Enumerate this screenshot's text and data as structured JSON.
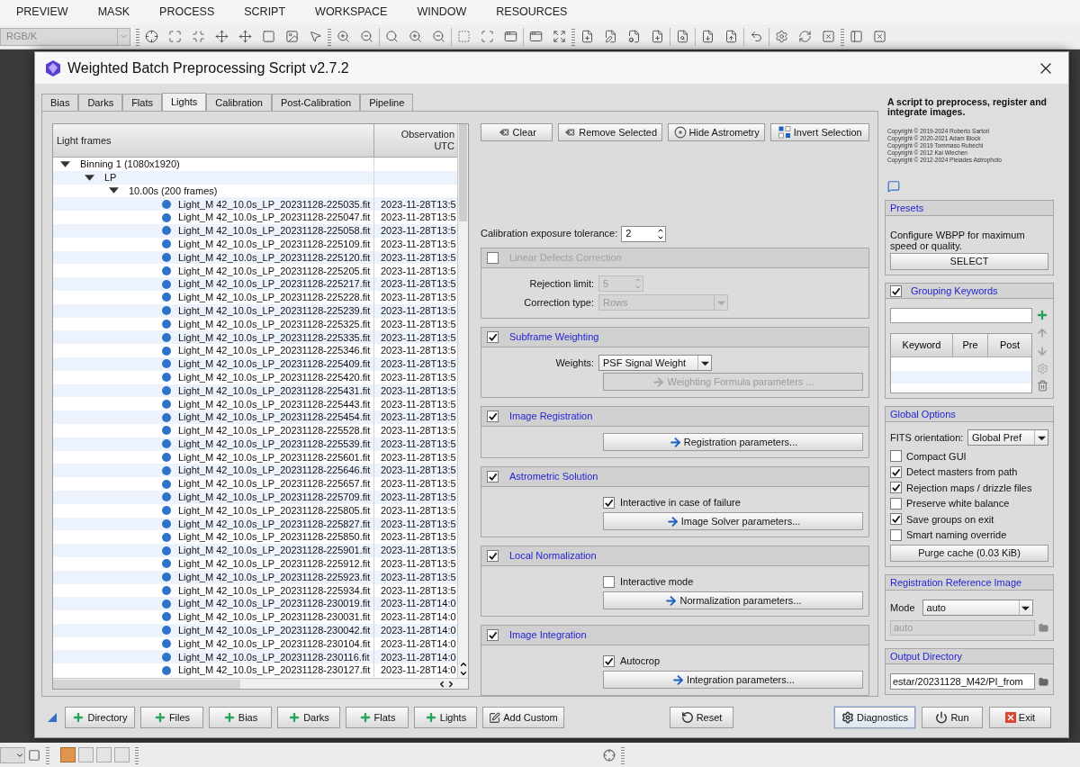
{
  "menu_bar": [
    "PREVIEW",
    "MASK",
    "PROCESS",
    "SCRIPT",
    "WORKSPACE",
    "WINDOW",
    "RESOURCES"
  ],
  "toolbar": {
    "view_select": "RGB/K"
  },
  "window": {
    "title": "Weighted Batch Preprocessing Script v2.7.2"
  },
  "tabs": [
    {
      "label": "Bias",
      "selected": false
    },
    {
      "label": "Darks",
      "selected": false
    },
    {
      "label": "Flats",
      "selected": false
    },
    {
      "label": "Lights",
      "selected": true
    },
    {
      "label": "Calibration",
      "selected": false
    },
    {
      "label": "Post-Calibration",
      "selected": false
    },
    {
      "label": "Pipeline",
      "selected": false
    }
  ],
  "file_list": {
    "columns": [
      "Light frames",
      "Observation UTC"
    ],
    "tree": [
      {
        "label": "Binning 1 (1080x1920)",
        "expanded": true,
        "children": [
          {
            "label": "LP",
            "expanded": true,
            "children": [
              {
                "label": "10.00s (200 frames)",
                "expanded": true,
                "children": [
                  {
                    "label": "Light_M 42_10.0s_LP_20231128-225035.fit",
                    "observation": "2023-11-28T13:5"
                  },
                  {
                    "label": "Light_M 42_10.0s_LP_20231128-225047.fit",
                    "observation": "2023-11-28T13:5"
                  },
                  {
                    "label": "Light_M 42_10.0s_LP_20231128-225058.fit",
                    "observation": "2023-11-28T13:5"
                  },
                  {
                    "label": "Light_M 42_10.0s_LP_20231128-225109.fit",
                    "observation": "2023-11-28T13:5"
                  },
                  {
                    "label": "Light_M 42_10.0s_LP_20231128-225120.fit",
                    "observation": "2023-11-28T13:5"
                  },
                  {
                    "label": "Light_M 42_10.0s_LP_20231128-225205.fit",
                    "observation": "2023-11-28T13:5"
                  },
                  {
                    "label": "Light_M 42_10.0s_LP_20231128-225217.fit",
                    "observation": "2023-11-28T13:5"
                  },
                  {
                    "label": "Light_M 42_10.0s_LP_20231128-225228.fit",
                    "observation": "2023-11-28T13:5"
                  },
                  {
                    "label": "Light_M 42_10.0s_LP_20231128-225239.fit",
                    "observation": "2023-11-28T13:5"
                  },
                  {
                    "label": "Light_M 42_10.0s_LP_20231128-225325.fit",
                    "observation": "2023-11-28T13:5"
                  },
                  {
                    "label": "Light_M 42_10.0s_LP_20231128-225335.fit",
                    "observation": "2023-11-28T13:5"
                  },
                  {
                    "label": "Light_M 42_10.0s_LP_20231128-225346.fit",
                    "observation": "2023-11-28T13:5"
                  },
                  {
                    "label": "Light_M 42_10.0s_LP_20231128-225409.fit",
                    "observation": "2023-11-28T13:5"
                  },
                  {
                    "label": "Light_M 42_10.0s_LP_20231128-225420.fit",
                    "observation": "2023-11-28T13:5"
                  },
                  {
                    "label": "Light_M 42_10.0s_LP_20231128-225431.fit",
                    "observation": "2023-11-28T13:5"
                  },
                  {
                    "label": "Light_M 42_10.0s_LP_20231128-225443.fit",
                    "observation": "2023-11-28T13:5"
                  },
                  {
                    "label": "Light_M 42_10.0s_LP_20231128-225454.fit",
                    "observation": "2023-11-28T13:5"
                  },
                  {
                    "label": "Light_M 42_10.0s_LP_20231128-225528.fit",
                    "observation": "2023-11-28T13:5"
                  },
                  {
                    "label": "Light_M 42_10.0s_LP_20231128-225539.fit",
                    "observation": "2023-11-28T13:5"
                  },
                  {
                    "label": "Light_M 42_10.0s_LP_20231128-225601.fit",
                    "observation": "2023-11-28T13:5"
                  },
                  {
                    "label": "Light_M 42_10.0s_LP_20231128-225646.fit",
                    "observation": "2023-11-28T13:5"
                  },
                  {
                    "label": "Light_M 42_10.0s_LP_20231128-225657.fit",
                    "observation": "2023-11-28T13:5"
                  },
                  {
                    "label": "Light_M 42_10.0s_LP_20231128-225709.fit",
                    "observation": "2023-11-28T13:5"
                  },
                  {
                    "label": "Light_M 42_10.0s_LP_20231128-225805.fit",
                    "observation": "2023-11-28T13:5"
                  },
                  {
                    "label": "Light_M 42_10.0s_LP_20231128-225827.fit",
                    "observation": "2023-11-28T13:5"
                  },
                  {
                    "label": "Light_M 42_10.0s_LP_20231128-225850.fit",
                    "observation": "2023-11-28T13:5"
                  },
                  {
                    "label": "Light_M 42_10.0s_LP_20231128-225901.fit",
                    "observation": "2023-11-28T13:5"
                  },
                  {
                    "label": "Light_M 42_10.0s_LP_20231128-225912.fit",
                    "observation": "2023-11-28T13:5"
                  },
                  {
                    "label": "Light_M 42_10.0s_LP_20231128-225923.fit",
                    "observation": "2023-11-28T13:5"
                  },
                  {
                    "label": "Light_M 42_10.0s_LP_20231128-225934.fit",
                    "observation": "2023-11-28T13:5"
                  },
                  {
                    "label": "Light_M 42_10.0s_LP_20231128-230019.fit",
                    "observation": "2023-11-28T14:0"
                  },
                  {
                    "label": "Light_M 42_10.0s_LP_20231128-230031.fit",
                    "observation": "2023-11-28T14:0"
                  },
                  {
                    "label": "Light_M 42_10.0s_LP_20231128-230042.fit",
                    "observation": "2023-11-28T14:0"
                  },
                  {
                    "label": "Light_M 42_10.0s_LP_20231128-230104.fit",
                    "observation": "2023-11-28T14:0"
                  },
                  {
                    "label": "Light_M 42_10.0s_LP_20231128-230116.fit",
                    "observation": "2023-11-28T14:0"
                  },
                  {
                    "label": "Light_M 42_10.0s_LP_20231128-230127.fit",
                    "observation": "2023-11-28T14:0"
                  }
                ]
              }
            ]
          }
        ]
      }
    ]
  },
  "list_buttons": [
    {
      "kind": "clear",
      "label": "Clear"
    },
    {
      "kind": "remove",
      "label": "Remove Selected"
    },
    {
      "kind": "astrometry",
      "label": "Hide Astrometry"
    },
    {
      "kind": "invert",
      "label": "Invert Selection"
    }
  ],
  "exposure_tolerance": {
    "label": "Calibration exposure tolerance:",
    "value": "2"
  },
  "sections": [
    {
      "title": "Linear Defects Correction",
      "checked": false,
      "rows": [
        {
          "kind": "spin",
          "label": "Rejection limit:",
          "value": "5",
          "disabled": true
        },
        {
          "kind": "select",
          "label": "Correction type:",
          "value": "Rows",
          "disabled": true
        }
      ]
    },
    {
      "title": "Subframe Weighting",
      "checked": true,
      "rows": [
        {
          "kind": "select",
          "label": "Weights:",
          "value": "PSF Signal Weight",
          "disabled": false
        },
        {
          "kind": "button",
          "label": "Weighting Formula parameters ...",
          "disabled": true
        }
      ]
    },
    {
      "title": "Image Registration",
      "checked": true,
      "rows": [
        {
          "kind": "button",
          "label": "Registration parameters...",
          "disabled": false
        }
      ]
    },
    {
      "title": "Astrometric Solution",
      "checked": true,
      "rows": [
        {
          "kind": "checkbox",
          "label": "Interactive in case of failure",
          "checked": true,
          "disabled": false
        },
        {
          "kind": "button",
          "label": "Image Solver parameters...",
          "disabled": false
        }
      ]
    },
    {
      "title": "Local Normalization",
      "checked": true,
      "rows": [
        {
          "kind": "checkbox",
          "label": "Interactive mode",
          "checked": false,
          "disabled": false
        },
        {
          "kind": "button",
          "label": "Normalization parameters...",
          "disabled": false
        }
      ]
    },
    {
      "title": "Image Integration",
      "checked": true,
      "rows": [
        {
          "kind": "checkbox",
          "label": "Autocrop",
          "checked": true,
          "disabled": false
        },
        {
          "kind": "button",
          "label": "Integration parameters...",
          "disabled": false
        }
      ]
    }
  ],
  "about": {
    "description": "A script to preprocess, register and integrate images.",
    "copyrights": [
      "Copyright © 2019-2024 Roberto Sartori",
      "Copyright © 2020-2021 Adam Block",
      "Copyright © 2019 Tommaso Rubechi",
      "Copyright © 2012 Kai Wiechen",
      "Copyright © 2012-2024 Pleiades Astrophoto"
    ]
  },
  "presets": {
    "title": "Presets",
    "text": "Configure WBPP for maximum speed or quality.",
    "button": "SELECT"
  },
  "grouping_keywords": {
    "title": "Grouping Keywords",
    "checked": true,
    "columns": [
      "Keyword",
      "Pre",
      "Post"
    ]
  },
  "global_options": {
    "title": "Global Options",
    "fits_label": "FITS orientation:",
    "fits_value": "Global Pref",
    "options": [
      {
        "label": "Compact GUI",
        "checked": false
      },
      {
        "label": "Detect masters from path",
        "checked": true
      },
      {
        "label": "Rejection maps / drizzle files",
        "checked": true
      },
      {
        "label": "Preserve white balance",
        "checked": false
      },
      {
        "label": "Save groups on exit",
        "checked": true
      },
      {
        "label": "Smart naming override",
        "checked": false
      }
    ],
    "purge_button": "Purge cache (0.03 KiB)"
  },
  "registration_reference": {
    "title": "Registration Reference Image",
    "mode_label": "Mode",
    "mode_value": "auto",
    "file_value": "auto"
  },
  "output_directory": {
    "title": "Output Directory",
    "value": "estar/20231128_M42/PI_from"
  },
  "bottom_buttons": [
    {
      "kind": "add",
      "label": "Directory",
      "focused": false
    },
    {
      "kind": "add",
      "label": "Files",
      "focused": false
    },
    {
      "kind": "add",
      "label": "Bias",
      "focused": false
    },
    {
      "kind": "add",
      "label": "Darks",
      "focused": false
    },
    {
      "kind": "add",
      "label": "Flats",
      "focused": false
    },
    {
      "kind": "add",
      "label": "Lights",
      "focused": false
    },
    {
      "kind": "custom",
      "label": "Add Custom",
      "focused": false
    },
    {
      "kind": "reset",
      "label": "Reset",
      "focused": false
    },
    {
      "kind": "diagnostics",
      "label": "Diagnostics",
      "focused": true
    },
    {
      "kind": "run",
      "label": "Run",
      "focused": false
    },
    {
      "kind": "exit",
      "label": "Exit",
      "focused": false
    }
  ]
}
